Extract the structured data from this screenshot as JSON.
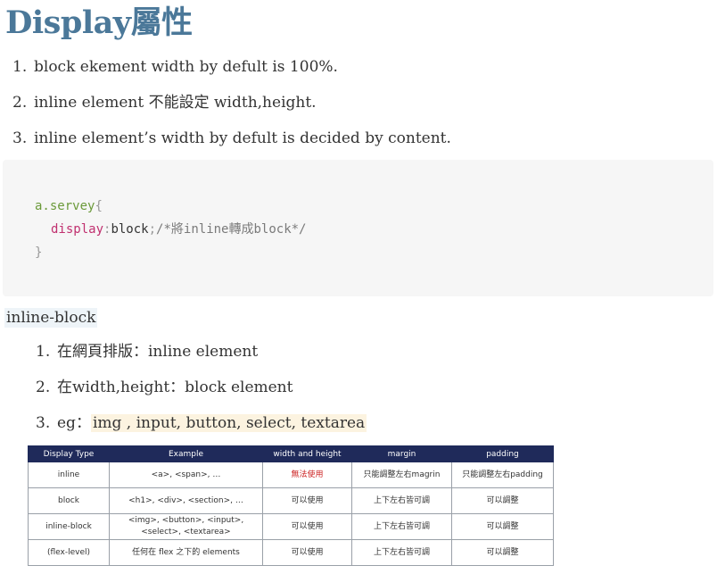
{
  "title": "Display屬性",
  "list1": [
    {
      "num": "1.",
      "text": "block ekement width by defult is 100%."
    },
    {
      "num": "2.",
      "text": "inline element 不能設定 width,height."
    },
    {
      "num": "3.",
      "text": "inline element’s width by defult is decided by content."
    }
  ],
  "code": {
    "selector": "a.servey",
    "open_brace": "{",
    "property": "display",
    "colon": ":",
    "value": "block",
    "semicolon": ";",
    "comment": "/*將inline轉成block*/",
    "close_brace": "}"
  },
  "inline_block_label": "inline-block",
  "list2": [
    {
      "num": "1.",
      "text": "在網頁排版：inline element"
    },
    {
      "num": "2.",
      "text": "在width,height：block element"
    },
    {
      "num": "3.",
      "prefix": "eg：",
      "highlight": "img , input, button, select, textarea"
    }
  ],
  "table": {
    "headers": [
      "Display Type",
      "Example",
      "width and height",
      "margin",
      "padding"
    ],
    "rows": [
      [
        "inline",
        "<a>, <span>, …",
        "無法使用",
        "只能調整左右magrin",
        "只能調整左右padding"
      ],
      [
        "block",
        "<h1>, <div>, <section>, …",
        "可以使用",
        "上下左右皆可調",
        "可以調整"
      ],
      [
        "inline-block",
        "<img>,  <button>, <input>,",
        "<select>, <textarea>",
        "可以使用",
        "上下左右皆可調",
        "可以調整"
      ],
      [
        "(flex-level)",
        "任何在 flex 之下的 elements",
        "可以使用",
        "上下左右皆可調",
        "可以調整"
      ]
    ],
    "accent_color": "#cc2222",
    "header_color": "#1f2a5a"
  }
}
